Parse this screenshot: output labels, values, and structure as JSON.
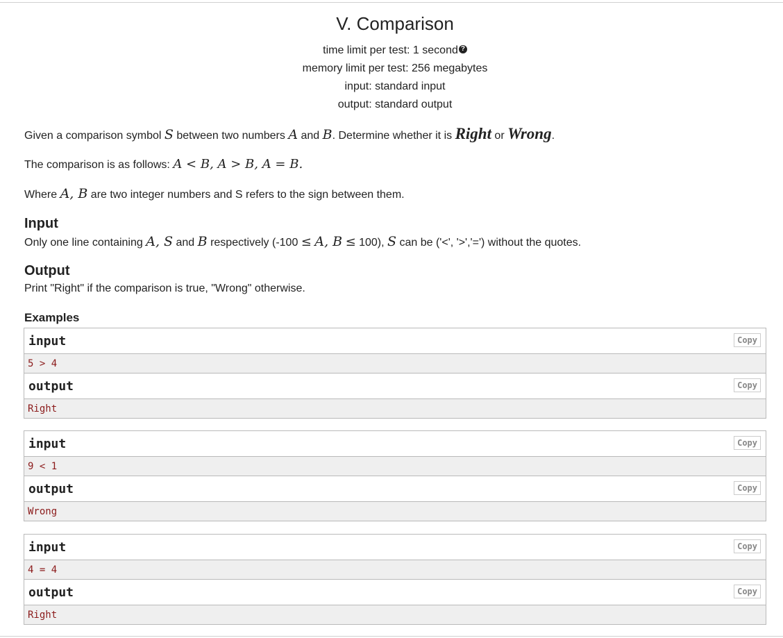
{
  "header": {
    "title": "V. Comparison",
    "time_limit": "time limit per test: 1 second",
    "memory_limit": "memory limit per test: 256 megabytes",
    "input": "input: standard input",
    "output": "output: standard output"
  },
  "statement": {
    "p1": {
      "a": "Given a comparison symbol ",
      "S": "S",
      "b": " between two numbers ",
      "A": "A",
      "c": " and ",
      "B": "B",
      "d": ". Determine whether it is ",
      "right": "Right",
      "e": " or ",
      "wrong": "Wrong",
      "f": "."
    },
    "p2": {
      "a": "The comparison is as follows: ",
      "expr": "A < B, A > B, A = B."
    },
    "p3": {
      "a": "Where ",
      "vars": "A, B",
      "b": " are two integer numbers and S refers to the sign between them."
    }
  },
  "input_section": {
    "title": "Input",
    "a": "Only one line containing ",
    "vars": "A, S",
    "b": " and ",
    "B": "B",
    "c": " respectively (-100 ",
    "le1": "≤",
    "mid": "A, B",
    "le2": "≤",
    "d": " 100), ",
    "S": "S",
    "e": " can be ('<', '>','=') without the quotes."
  },
  "output_section": {
    "title": "Output",
    "text": "Print \"Right\" if the comparison is true, \"Wrong\" otherwise."
  },
  "examples": {
    "title": "Examples",
    "copy_label": "Copy",
    "input_label": "input",
    "output_label": "output",
    "items": [
      {
        "input": "5 > 4",
        "output": "Right"
      },
      {
        "input": "9 < 1",
        "output": "Wrong"
      },
      {
        "input": "4 = 4",
        "output": "Right"
      }
    ]
  }
}
